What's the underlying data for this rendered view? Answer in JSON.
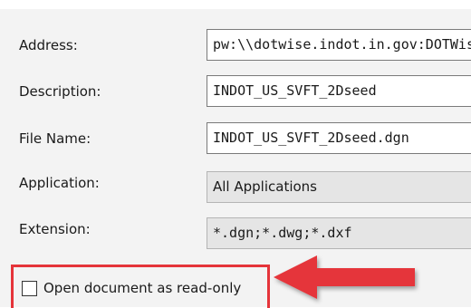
{
  "form": {
    "address_label": "Address:",
    "address_value": "pw:\\\\dotwise.indot.in.gov:DOTWis",
    "description_label": "Description:",
    "description_value": "INDOT_US_SVFT_2Dseed",
    "filename_label": "File Name:",
    "filename_value": "INDOT_US_SVFT_2Dseed.dgn",
    "application_label": "Application:",
    "application_value": "All Applications",
    "extension_label": "Extension:",
    "extension_value": "*.dgn;*.dwg;*.dxf"
  },
  "options": {
    "readonly_label": "Open document as read-only",
    "readonly_checked": false
  },
  "colors": {
    "highlight": "#e5343a",
    "field_border": "#7a7a7a",
    "readonly_bg": "#e5e5e5"
  }
}
